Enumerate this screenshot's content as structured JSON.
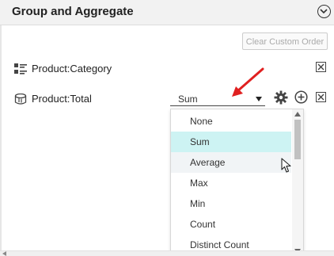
{
  "panel": {
    "title": "Group and Aggregate",
    "clear_button": "Clear Custom Order"
  },
  "fields": [
    {
      "label": "Product:Category",
      "icon": "grouping-icon"
    },
    {
      "label": "Product:Total",
      "icon": "measure-icon"
    }
  ],
  "aggregate_select": {
    "value": "Sum",
    "options": [
      "None",
      "Sum",
      "Average",
      "Max",
      "Min",
      "Count",
      "Distinct Count"
    ],
    "selected_index": 1,
    "hover_index": 2
  },
  "colors": {
    "header_bg": "#f2f2f2",
    "selected_bg": "#cdf3f3",
    "arrow": "#e02020"
  }
}
